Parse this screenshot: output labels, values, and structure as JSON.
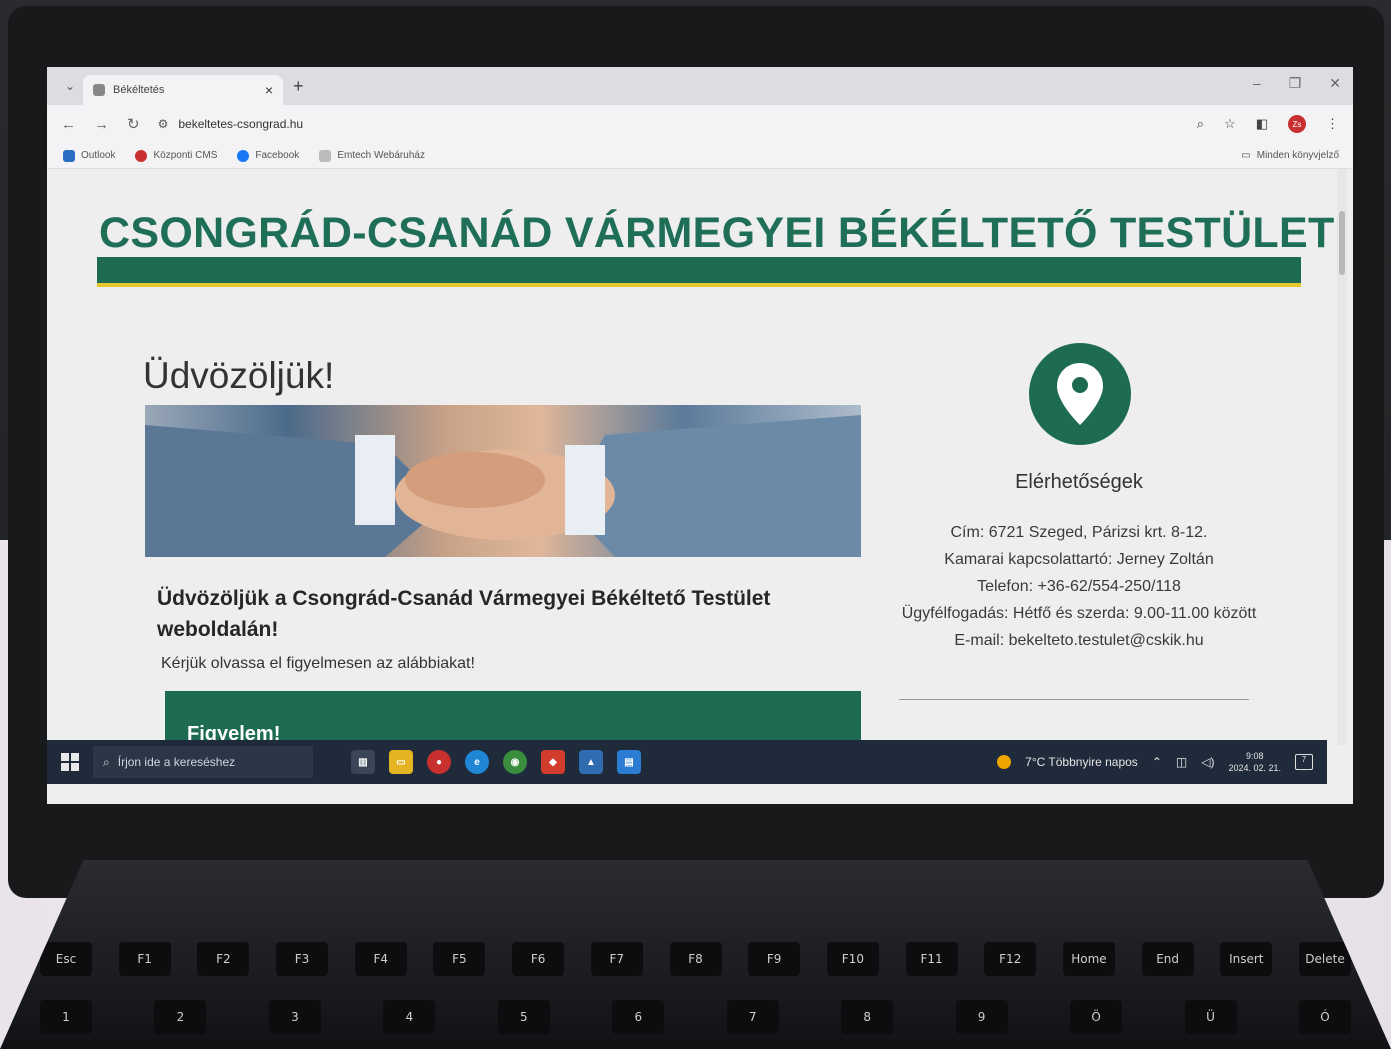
{
  "browser": {
    "tab_title": "Békéltetés",
    "url": "bekeltetes-csongrad.hu",
    "bookmarks": [
      "Outlook",
      "Központi CMS",
      "Facebook",
      "Emtech Webáruház"
    ],
    "all_bookmarks_label": "Minden könyvjelző",
    "profile_initials": "Zs"
  },
  "page": {
    "site_title": "CSONGRÁD-CSANÁD VÁRMEGYEI BÉKÉLTETŐ TESTÜLET",
    "welcome_heading": "Üdvözöljük!",
    "intro_heading": "Üdvözöljük a Csongrád-Csanád Vármegyei Békéltető Testület weboldalán!",
    "intro_text": "Kérjük olvassa el figyelmesen az alábbiakat!",
    "notice_title": "Figyelem!",
    "contact": {
      "title": "Elérhetőségek",
      "address": "Cím: 6721 Szeged, Párizsi krt. 8-12.",
      "liaison": "Kamarai kapcsolattartó: Jerney Zoltán",
      "phone": "Telefon: +36-62/554-250/118",
      "hours": "Ügyfélfogadás: Hétfő és szerda: 9.00-11.00 között",
      "email": "E-mail: bekelteto.testulet@cskik.hu"
    }
  },
  "taskbar": {
    "search_placeholder": "Írjon ide a kereséshez",
    "weather": "7°C  Többnyire napos",
    "time": "9:08",
    "date": "2024. 02. 21.",
    "notifications": "7"
  },
  "keyboard": {
    "fn_row": [
      "Esc",
      "F1",
      "F2",
      "F3",
      "F4",
      "F5",
      "F6",
      "F7",
      "F8",
      "F9",
      "F10",
      "F11",
      "F12",
      "Home",
      "End",
      "Insert",
      "Delete"
    ],
    "num_row": [
      "1",
      "2",
      "3",
      "4",
      "5",
      "6",
      "7",
      "8",
      "9",
      "Ö",
      "Ü",
      "Ó"
    ]
  },
  "colors": {
    "brand_green": "#1c6b52",
    "accent_yellow": "#e6c62a",
    "title_green": "#1e6e58"
  }
}
